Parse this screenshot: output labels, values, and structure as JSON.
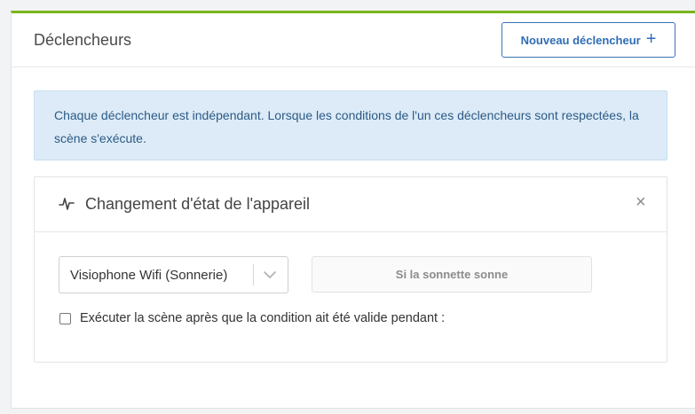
{
  "header": {
    "title": "Déclencheurs",
    "new_button_label": "Nouveau déclencheur",
    "new_button_icon": "plus-icon"
  },
  "info": {
    "text": "Chaque déclencheur est indépendant. Lorsque les conditions de l'un ces déclencheurs sont respectées, la scène s'exécute."
  },
  "trigger_card": {
    "icon": "pulse-icon",
    "title": "Changement d'état de l'appareil",
    "close_icon": "close-icon",
    "device_select": {
      "value": "Visiophone Wifi (Sonnerie)",
      "icon": "chevron-down-icon"
    },
    "condition_button_label": "Si la sonnette sonne",
    "delay_checkbox": {
      "label": "Exécuter la scène après que la condition ait été valide pendant :",
      "checked": false
    }
  },
  "colors": {
    "accent_top": "#7ab51d",
    "primary": "#2f6db5",
    "info_bg": "#dcebf7"
  }
}
